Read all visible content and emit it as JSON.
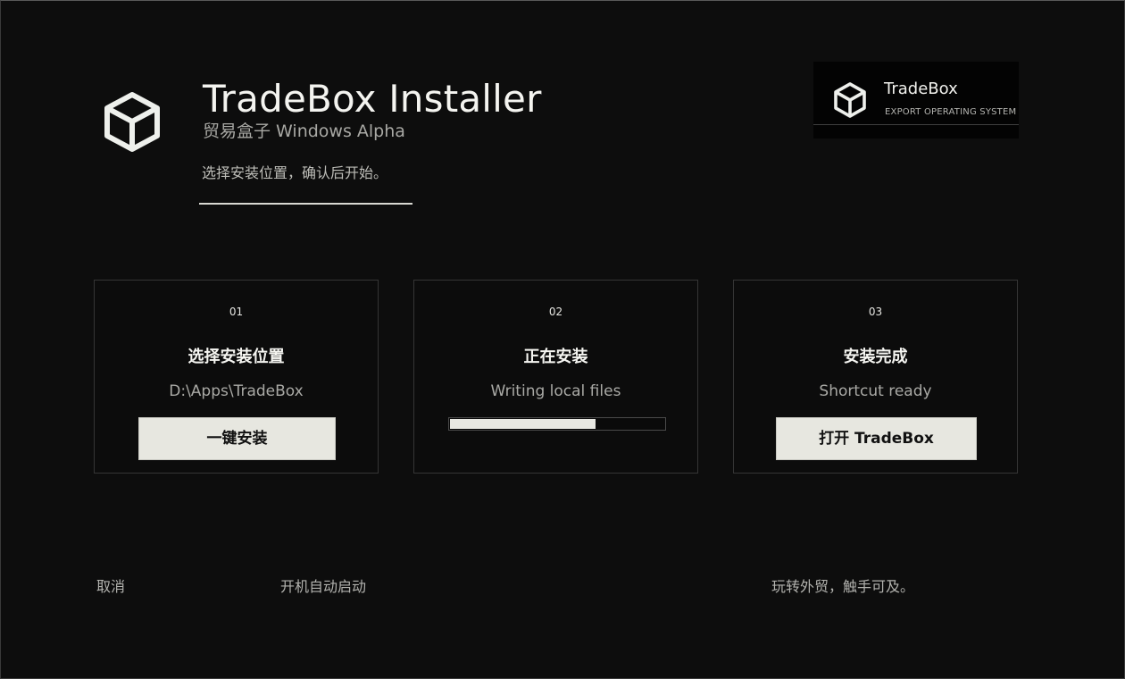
{
  "header": {
    "title": "TradeBox Installer",
    "subtitle": "贸易盒子 Windows Alpha",
    "instruction": "选择安装位置，确认后开始。",
    "logo_icon": "cube-icon"
  },
  "brand_badge": {
    "name": "TradeBox",
    "tagline": "EXPORT OPERATING SYSTEM",
    "logo_icon": "cube-icon"
  },
  "steps": [
    {
      "number": "01",
      "title": "选择安装位置",
      "detail": "D:\\Apps\\TradeBox",
      "button_label": "一键安装"
    },
    {
      "number": "02",
      "title": "正在安装",
      "detail": "Writing local files",
      "progress": 0.68
    },
    {
      "number": "03",
      "title": "安装完成",
      "detail": "Shortcut ready",
      "button_label": "打开 TradeBox"
    }
  ],
  "footer": {
    "cancel_label": "取消",
    "autostart_label": "开机自动启动",
    "slogan": "玩转外贸，触手可及。"
  },
  "colors": {
    "background": "#0d0d0d",
    "button_background": "#e7e7e0",
    "progress_fill": "#e8e8e2",
    "card_border": "#353535"
  }
}
